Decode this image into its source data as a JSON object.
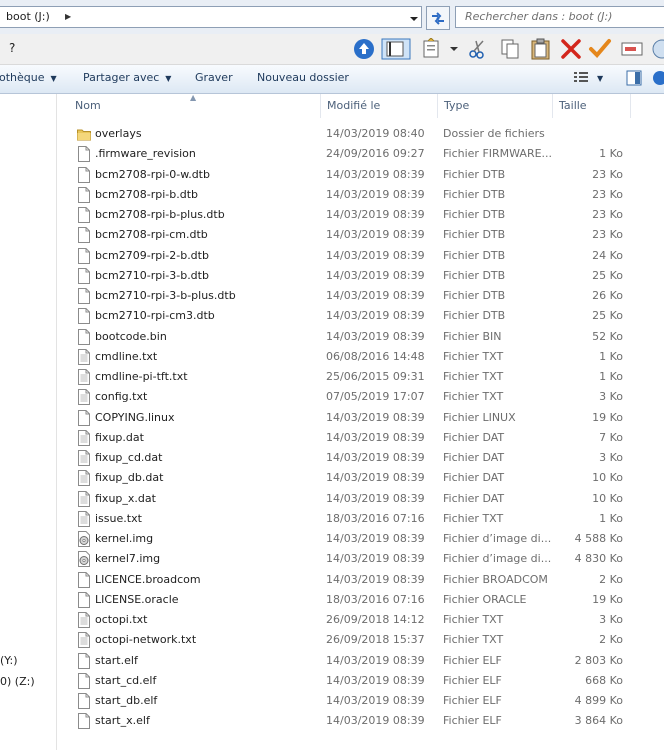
{
  "address": {
    "path": "boot (J:)",
    "search_placeholder": "Rechercher dans : boot (J:)"
  },
  "menubar": {
    "help": "?"
  },
  "commandbar": {
    "library": "othèque",
    "share": "Partager avec",
    "burn": "Graver",
    "new_folder": "Nouveau dossier"
  },
  "columns": {
    "name": "Nom",
    "modified": "Modifié le",
    "type": "Type",
    "size": "Taille"
  },
  "navpane": {
    "drive_y": "(Y:)",
    "drive_z": "0) (Z:)"
  },
  "files": [
    {
      "name": "overlays",
      "date": "14/03/2019 08:40",
      "type": "Dossier de fichiers",
      "size": "",
      "icon": "folder-icon"
    },
    {
      "name": ".firmware_revision",
      "date": "24/09/2016 09:27",
      "type": "Fichier FIRMWARE...",
      "size": "1 Ko",
      "icon": "file-icon"
    },
    {
      "name": "bcm2708-rpi-0-w.dtb",
      "date": "14/03/2019 08:39",
      "type": "Fichier DTB",
      "size": "23 Ko",
      "icon": "file-icon"
    },
    {
      "name": "bcm2708-rpi-b.dtb",
      "date": "14/03/2019 08:39",
      "type": "Fichier DTB",
      "size": "23 Ko",
      "icon": "file-icon"
    },
    {
      "name": "bcm2708-rpi-b-plus.dtb",
      "date": "14/03/2019 08:39",
      "type": "Fichier DTB",
      "size": "23 Ko",
      "icon": "file-icon"
    },
    {
      "name": "bcm2708-rpi-cm.dtb",
      "date": "14/03/2019 08:39",
      "type": "Fichier DTB",
      "size": "23 Ko",
      "icon": "file-icon"
    },
    {
      "name": "bcm2709-rpi-2-b.dtb",
      "date": "14/03/2019 08:39",
      "type": "Fichier DTB",
      "size": "24 Ko",
      "icon": "file-icon"
    },
    {
      "name": "bcm2710-rpi-3-b.dtb",
      "date": "14/03/2019 08:39",
      "type": "Fichier DTB",
      "size": "25 Ko",
      "icon": "file-icon"
    },
    {
      "name": "bcm2710-rpi-3-b-plus.dtb",
      "date": "14/03/2019 08:39",
      "type": "Fichier DTB",
      "size": "26 Ko",
      "icon": "file-icon"
    },
    {
      "name": "bcm2710-rpi-cm3.dtb",
      "date": "14/03/2019 08:39",
      "type": "Fichier DTB",
      "size": "25 Ko",
      "icon": "file-icon"
    },
    {
      "name": "bootcode.bin",
      "date": "14/03/2019 08:39",
      "type": "Fichier BIN",
      "size": "52 Ko",
      "icon": "file-icon"
    },
    {
      "name": "cmdline.txt",
      "date": "06/08/2016 14:48",
      "type": "Fichier TXT",
      "size": "1 Ko",
      "icon": "text-file-icon"
    },
    {
      "name": "cmdline-pi-tft.txt",
      "date": "25/06/2015 09:31",
      "type": "Fichier TXT",
      "size": "1 Ko",
      "icon": "text-file-icon"
    },
    {
      "name": "config.txt",
      "date": "07/05/2019 17:07",
      "type": "Fichier TXT",
      "size": "3 Ko",
      "icon": "text-file-icon"
    },
    {
      "name": "COPYING.linux",
      "date": "14/03/2019 08:39",
      "type": "Fichier LINUX",
      "size": "19 Ko",
      "icon": "file-icon"
    },
    {
      "name": "fixup.dat",
      "date": "14/03/2019 08:39",
      "type": "Fichier DAT",
      "size": "7 Ko",
      "icon": "text-file-icon"
    },
    {
      "name": "fixup_cd.dat",
      "date": "14/03/2019 08:39",
      "type": "Fichier DAT",
      "size": "3 Ko",
      "icon": "text-file-icon"
    },
    {
      "name": "fixup_db.dat",
      "date": "14/03/2019 08:39",
      "type": "Fichier DAT",
      "size": "10 Ko",
      "icon": "text-file-icon"
    },
    {
      "name": "fixup_x.dat",
      "date": "14/03/2019 08:39",
      "type": "Fichier DAT",
      "size": "10 Ko",
      "icon": "text-file-icon"
    },
    {
      "name": "issue.txt",
      "date": "18/03/2016 07:16",
      "type": "Fichier TXT",
      "size": "1 Ko",
      "icon": "text-file-icon"
    },
    {
      "name": "kernel.img",
      "date": "14/03/2019 08:39",
      "type": "Fichier d’image di...",
      "size": "4 588 Ko",
      "icon": "disk-image-icon"
    },
    {
      "name": "kernel7.img",
      "date": "14/03/2019 08:39",
      "type": "Fichier d’image di...",
      "size": "4 830 Ko",
      "icon": "disk-image-icon"
    },
    {
      "name": "LICENCE.broadcom",
      "date": "14/03/2019 08:39",
      "type": "Fichier BROADCOM",
      "size": "2 Ko",
      "icon": "file-icon"
    },
    {
      "name": "LICENSE.oracle",
      "date": "18/03/2016 07:16",
      "type": "Fichier ORACLE",
      "size": "19 Ko",
      "icon": "file-icon"
    },
    {
      "name": "octopi.txt",
      "date": "26/09/2018 14:12",
      "type": "Fichier TXT",
      "size": "3 Ko",
      "icon": "text-file-icon"
    },
    {
      "name": "octopi-network.txt",
      "date": "26/09/2018 15:37",
      "type": "Fichier TXT",
      "size": "2 Ko",
      "icon": "text-file-icon"
    },
    {
      "name": "start.elf",
      "date": "14/03/2019 08:39",
      "type": "Fichier ELF",
      "size": "2 803 Ko",
      "icon": "file-icon"
    },
    {
      "name": "start_cd.elf",
      "date": "14/03/2019 08:39",
      "type": "Fichier ELF",
      "size": "668 Ko",
      "icon": "file-icon"
    },
    {
      "name": "start_db.elf",
      "date": "14/03/2019 08:39",
      "type": "Fichier ELF",
      "size": "4 899 Ko",
      "icon": "file-icon"
    },
    {
      "name": "start_x.elf",
      "date": "14/03/2019 08:39",
      "type": "Fichier ELF",
      "size": "3 864 Ko",
      "icon": "file-icon"
    }
  ]
}
